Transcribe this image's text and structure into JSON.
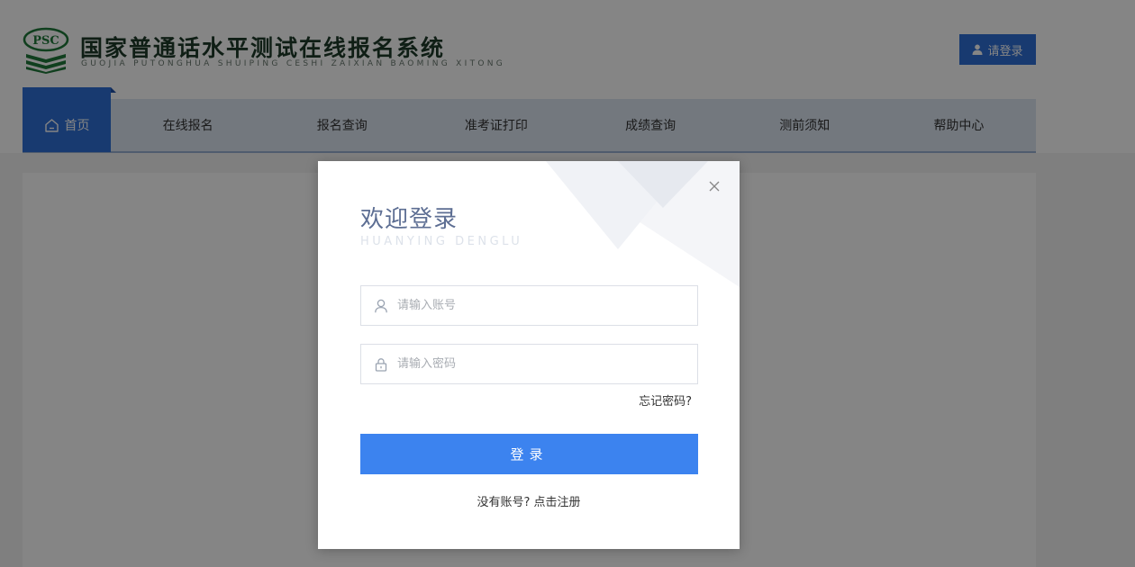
{
  "header": {
    "logo_text": "PSC",
    "title": "国家普通话水平测试在线报名系统",
    "subtitle": "GUOJIA PUTONGHUA SHUIPING CESHI ZAIXIAN BAOMING XITONG",
    "login_label": "请登录"
  },
  "nav": {
    "home_label": "首页",
    "items": [
      {
        "label": "在线报名"
      },
      {
        "label": "报名查询"
      },
      {
        "label": "准考证打印"
      },
      {
        "label": "成绩查询"
      },
      {
        "label": "测前须知"
      },
      {
        "label": "帮助中心"
      }
    ]
  },
  "modal": {
    "title": "欢迎登录",
    "subtitle": "HUANYING DENGLU",
    "account_placeholder": "请输入账号",
    "account_value": "",
    "password_placeholder": "请输入密码",
    "password_value": "",
    "forgot_label": "忘记密码?",
    "submit_label": "登录",
    "register_prefix": "没有账号?",
    "register_link": "点击注册"
  },
  "icons": {
    "logo": "psc-logo-icon",
    "user": "user-icon",
    "home": "home-icon",
    "lock": "lock-icon",
    "close": "close-icon"
  },
  "colors": {
    "primary": "#2f6fd6",
    "submit": "#3c83ef",
    "nav_bg": "#dde6f2",
    "title": "#5d6e93"
  }
}
